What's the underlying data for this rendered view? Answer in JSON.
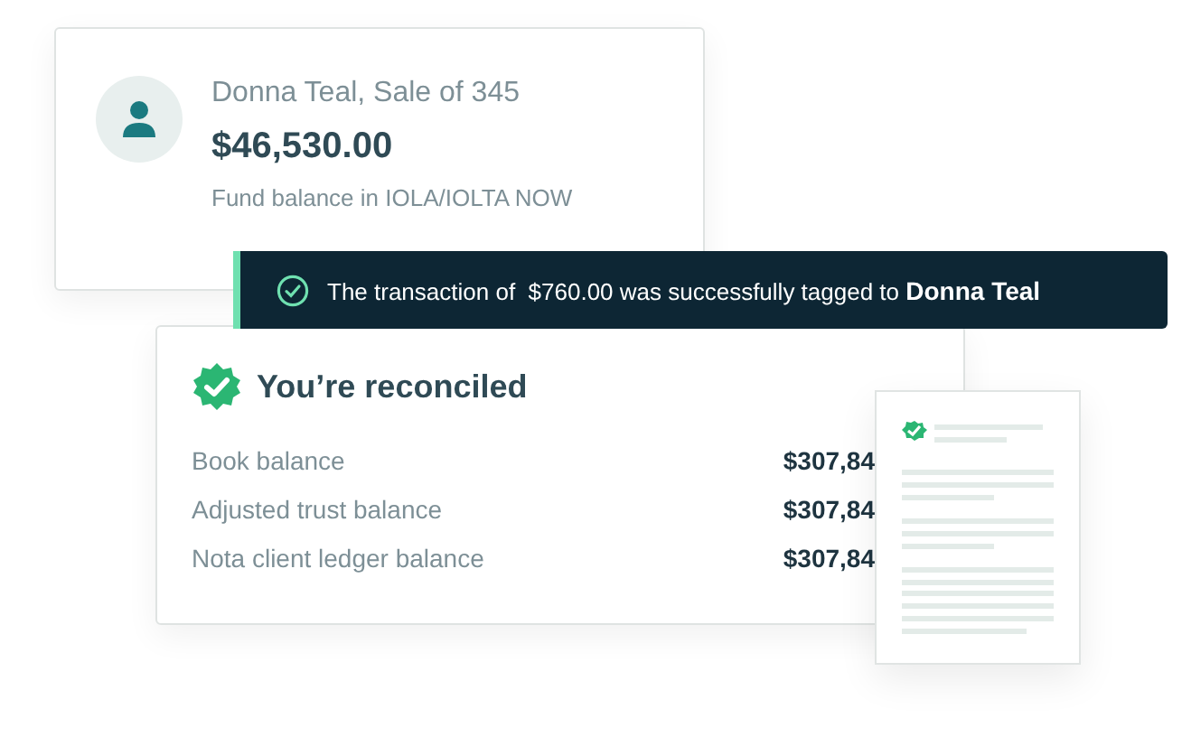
{
  "account_card": {
    "title": "Donna Teal, Sale of 345",
    "amount": "$46,530.00",
    "caption": "Fund balance in IOLA/IOLTA NOW"
  },
  "toast": {
    "message": "The transaction of  $760.00 was successfully tagged to **Donna Teal**"
  },
  "reconcile_card": {
    "title": "You’re reconciled",
    "rows": [
      {
        "label": "Book balance",
        "amount": "$307,84"
      },
      {
        "label": "Adjusted trust balance",
        "amount": "$307,84"
      },
      {
        "label": "Nota client ledger balance",
        "amount": "$307,84"
      }
    ]
  }
}
